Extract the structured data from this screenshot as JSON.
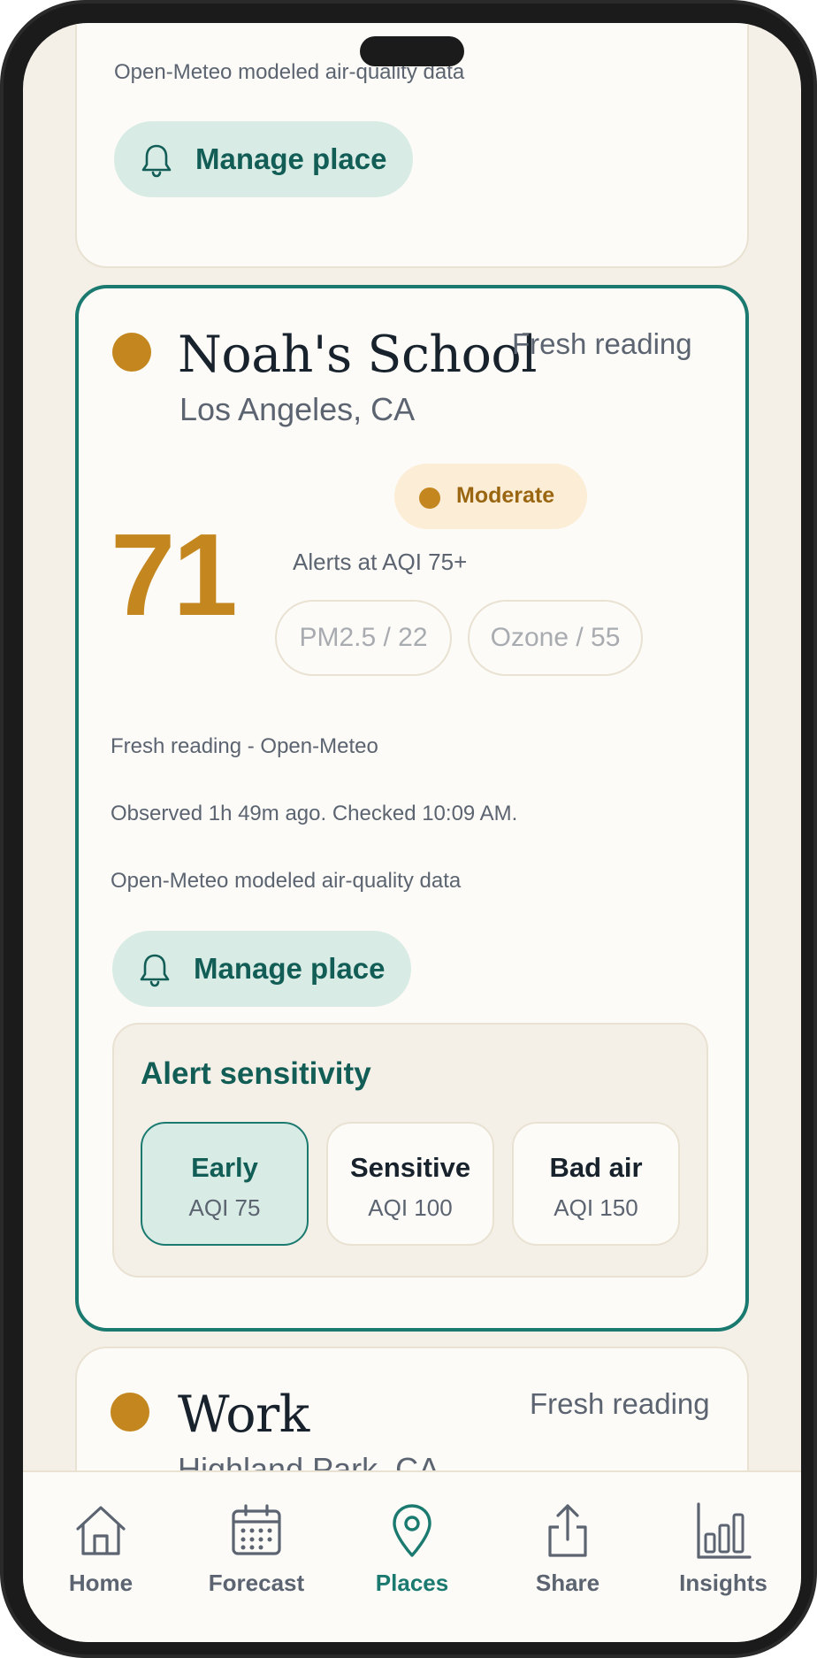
{
  "colors": {
    "accent": "#1b7a70",
    "moderate": "#c4861e",
    "background": "#f4f0e8",
    "card": "#fcfbf7"
  },
  "top_card": {
    "source_note": "Open-Meteo modeled air-quality data",
    "manage_label": "Manage place",
    "manage_icon": "bell-icon"
  },
  "place": {
    "name": "Noah's School",
    "location": "Los Angeles, CA",
    "status": "Fresh reading",
    "aqi": "71",
    "level": "Moderate",
    "alert_threshold": "Alerts at AQI 75+",
    "pollutants": [
      "PM2.5 / 22",
      "Ozone / 55"
    ],
    "reading_source": "Fresh reading - Open-Meteo",
    "observed": "Observed 1h 49m ago. Checked 10:09 AM.",
    "source_note": "Open-Meteo modeled air-quality data",
    "manage_label": "Manage place",
    "sensitivity": {
      "title": "Alert sensitivity",
      "selected": "Early",
      "options": [
        {
          "label": "Early",
          "value": "AQI 75"
        },
        {
          "label": "Sensitive",
          "value": "AQI 100"
        },
        {
          "label": "Bad air",
          "value": "AQI 150"
        }
      ]
    }
  },
  "next_place": {
    "name": "Work",
    "location": "Highland Park, CA",
    "status": "Fresh reading"
  },
  "nav": {
    "active": "Places",
    "items": [
      {
        "label": "Home",
        "icon": "home-icon"
      },
      {
        "label": "Forecast",
        "icon": "calendar-icon"
      },
      {
        "label": "Places",
        "icon": "map-pin-icon"
      },
      {
        "label": "Share",
        "icon": "share-icon"
      },
      {
        "label": "Insights",
        "icon": "bar-chart-icon"
      }
    ]
  }
}
